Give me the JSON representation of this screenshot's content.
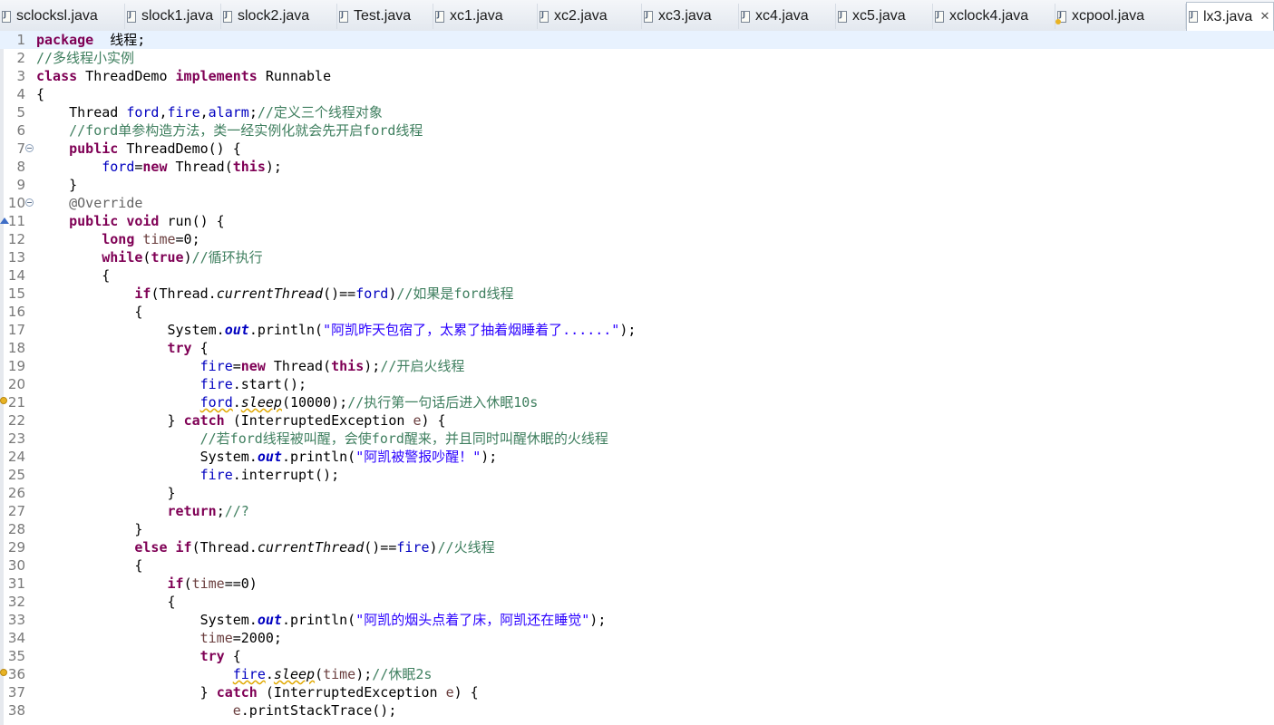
{
  "tabs": [
    {
      "label": "sclocksl.java",
      "active": false,
      "warn": false
    },
    {
      "label": "slock1.java",
      "active": false,
      "warn": false
    },
    {
      "label": "slock2.java",
      "active": false,
      "warn": false
    },
    {
      "label": "Test.java",
      "active": false,
      "warn": false
    },
    {
      "label": "xc1.java",
      "active": false,
      "warn": false
    },
    {
      "label": "xc2.java",
      "active": false,
      "warn": false
    },
    {
      "label": "xc3.java",
      "active": false,
      "warn": false
    },
    {
      "label": "xc4.java",
      "active": false,
      "warn": false
    },
    {
      "label": "xc5.java",
      "active": false,
      "warn": false
    },
    {
      "label": "xclock4.java",
      "active": false,
      "warn": false
    },
    {
      "label": "xcpool.java",
      "active": false,
      "warn": true
    },
    {
      "label": "lx3.java",
      "active": true,
      "warn": false,
      "close": "✕"
    }
  ],
  "editor": {
    "current_line": 1,
    "lines": [
      {
        "n": "1",
        "t": [
          [
            "kw",
            "package"
          ],
          [
            "",
            "  线程;"
          ]
        ]
      },
      {
        "n": "2",
        "t": [
          [
            "cm",
            "//多线程小实例"
          ]
        ]
      },
      {
        "n": "3",
        "t": [
          [
            "kw",
            "class"
          ],
          [
            "",
            " ThreadDemo "
          ],
          [
            "kw",
            "implements"
          ],
          [
            "",
            " Runnable"
          ]
        ]
      },
      {
        "n": "4",
        "t": [
          [
            "",
            "{"
          ]
        ]
      },
      {
        "n": "5",
        "t": [
          [
            "",
            "    Thread "
          ],
          [
            "fd",
            "ford"
          ],
          [
            "",
            ","
          ],
          [
            "fd",
            "fire"
          ],
          [
            "",
            ","
          ],
          [
            "fd",
            "alarm"
          ],
          [
            "",
            ";"
          ],
          [
            "cm",
            "//定义三个线程对象"
          ]
        ]
      },
      {
        "n": "6",
        "t": [
          [
            "cm",
            "    //ford单参构造方法，类一经实例化就会先开启ford线程"
          ]
        ]
      },
      {
        "n": "7",
        "fold": true,
        "t": [
          [
            "",
            "    "
          ],
          [
            "kw",
            "public"
          ],
          [
            "",
            " ThreadDemo() {"
          ]
        ]
      },
      {
        "n": "8",
        "t": [
          [
            "",
            "        "
          ],
          [
            "fd",
            "ford"
          ],
          [
            "",
            "="
          ],
          [
            "kw",
            "new"
          ],
          [
            "",
            " Thread("
          ],
          [
            "kw",
            "this"
          ],
          [
            "",
            ");"
          ]
        ]
      },
      {
        "n": "9",
        "t": [
          [
            "",
            "    }"
          ]
        ]
      },
      {
        "n": "10",
        "fold": true,
        "t": [
          [
            "",
            "    "
          ],
          [
            "an",
            "@Override"
          ]
        ]
      },
      {
        "n": "11",
        "marker": "override",
        "t": [
          [
            "",
            "    "
          ],
          [
            "kw",
            "public"
          ],
          [
            "",
            " "
          ],
          [
            "kw",
            "void"
          ],
          [
            "",
            " run() {"
          ]
        ]
      },
      {
        "n": "12",
        "t": [
          [
            "",
            "        "
          ],
          [
            "kw",
            "long"
          ],
          [
            "",
            " "
          ],
          [
            "lv",
            "time"
          ],
          [
            "",
            "=0;"
          ]
        ]
      },
      {
        "n": "13",
        "t": [
          [
            "",
            "        "
          ],
          [
            "kw",
            "while"
          ],
          [
            "",
            "("
          ],
          [
            "kw",
            "true"
          ],
          [
            "",
            ")"
          ],
          [
            "cm",
            "//循环执行"
          ]
        ]
      },
      {
        "n": "14",
        "t": [
          [
            "",
            "        {"
          ]
        ]
      },
      {
        "n": "15",
        "t": [
          [
            "",
            "            "
          ],
          [
            "kw",
            "if"
          ],
          [
            "",
            "(Thread."
          ],
          [
            "sm",
            "currentThread"
          ],
          [
            "",
            "()=="
          ],
          [
            "fd",
            "ford"
          ],
          [
            "",
            ")"
          ],
          [
            "cm",
            "//如果是ford线程"
          ]
        ]
      },
      {
        "n": "16",
        "t": [
          [
            "",
            "            {"
          ]
        ]
      },
      {
        "n": "17",
        "t": [
          [
            "",
            "                System."
          ],
          [
            "sf",
            "out"
          ],
          [
            "",
            ".println("
          ],
          [
            "st",
            "\"阿凯昨天包宿了，太累了抽着烟睡着了......\""
          ],
          [
            "",
            ");"
          ]
        ]
      },
      {
        "n": "18",
        "t": [
          [
            "",
            "                "
          ],
          [
            "kw",
            "try"
          ],
          [
            "",
            " {"
          ]
        ]
      },
      {
        "n": "19",
        "t": [
          [
            "",
            "                    "
          ],
          [
            "fd",
            "fire"
          ],
          [
            "",
            "="
          ],
          [
            "kw",
            "new"
          ],
          [
            "",
            " Thread("
          ],
          [
            "kw",
            "this"
          ],
          [
            "",
            ");"
          ],
          [
            "cm",
            "//开启火线程"
          ]
        ]
      },
      {
        "n": "20",
        "t": [
          [
            "",
            "                    "
          ],
          [
            "fd",
            "fire"
          ],
          [
            "",
            ".start();"
          ]
        ]
      },
      {
        "n": "21",
        "marker": "warn",
        "t": [
          [
            "",
            "                    "
          ],
          [
            "fd squig",
            "ford"
          ],
          [
            "",
            "."
          ],
          [
            "sm squig",
            "sleep"
          ],
          [
            "",
            "(10000);"
          ],
          [
            "cm",
            "//执行第一句话后进入休眠10s"
          ]
        ]
      },
      {
        "n": "22",
        "t": [
          [
            "",
            "                } "
          ],
          [
            "kw",
            "catch"
          ],
          [
            "",
            " (InterruptedException "
          ],
          [
            "lv",
            "e"
          ],
          [
            "",
            ") {"
          ]
        ]
      },
      {
        "n": "23",
        "t": [
          [
            "cm",
            "                    //若ford线程被叫醒，会使ford醒来，并且同时叫醒休眠的火线程"
          ]
        ]
      },
      {
        "n": "24",
        "t": [
          [
            "",
            "                    System."
          ],
          [
            "sf",
            "out"
          ],
          [
            "",
            ".println("
          ],
          [
            "st",
            "\"阿凯被警报吵醒！\""
          ],
          [
            "",
            ");"
          ]
        ]
      },
      {
        "n": "25",
        "t": [
          [
            "",
            "                    "
          ],
          [
            "fd",
            "fire"
          ],
          [
            "",
            ".interrupt();"
          ]
        ]
      },
      {
        "n": "26",
        "t": [
          [
            "",
            "                }"
          ]
        ]
      },
      {
        "n": "27",
        "t": [
          [
            "",
            "                "
          ],
          [
            "kw",
            "return"
          ],
          [
            "",
            ";"
          ],
          [
            "cm",
            "//?"
          ]
        ]
      },
      {
        "n": "28",
        "t": [
          [
            "",
            "            }"
          ]
        ]
      },
      {
        "n": "29",
        "t": [
          [
            "",
            "            "
          ],
          [
            "kw",
            "else"
          ],
          [
            "",
            " "
          ],
          [
            "kw",
            "if"
          ],
          [
            "",
            "(Thread."
          ],
          [
            "sm",
            "currentThread"
          ],
          [
            "",
            "()=="
          ],
          [
            "fd",
            "fire"
          ],
          [
            "",
            ")"
          ],
          [
            "cm",
            "//火线程"
          ]
        ]
      },
      {
        "n": "30",
        "t": [
          [
            "",
            "            {"
          ]
        ]
      },
      {
        "n": "31",
        "t": [
          [
            "",
            "                "
          ],
          [
            "kw",
            "if"
          ],
          [
            "",
            "("
          ],
          [
            "lv",
            "time"
          ],
          [
            "",
            "==0)"
          ]
        ]
      },
      {
        "n": "32",
        "t": [
          [
            "",
            "                {"
          ]
        ]
      },
      {
        "n": "33",
        "t": [
          [
            "",
            "                    System."
          ],
          [
            "sf",
            "out"
          ],
          [
            "",
            ".println("
          ],
          [
            "st",
            "\"阿凯的烟头点着了床，阿凯还在睡觉\""
          ],
          [
            "",
            ");"
          ]
        ]
      },
      {
        "n": "34",
        "t": [
          [
            "",
            "                    "
          ],
          [
            "lv",
            "time"
          ],
          [
            "",
            "=2000;"
          ]
        ]
      },
      {
        "n": "35",
        "t": [
          [
            "",
            "                    "
          ],
          [
            "kw",
            "try"
          ],
          [
            "",
            " {"
          ]
        ]
      },
      {
        "n": "36",
        "marker": "warn",
        "t": [
          [
            "",
            "                        "
          ],
          [
            "fd squig",
            "fire"
          ],
          [
            "",
            "."
          ],
          [
            "sm squig",
            "sleep"
          ],
          [
            "",
            "("
          ],
          [
            "lv",
            "time"
          ],
          [
            "",
            ");"
          ],
          [
            "cm",
            "//休眠2s"
          ]
        ]
      },
      {
        "n": "37",
        "t": [
          [
            "",
            "                    } "
          ],
          [
            "kw",
            "catch"
          ],
          [
            "",
            " (InterruptedException "
          ],
          [
            "lv",
            "e"
          ],
          [
            "",
            ") {"
          ]
        ]
      },
      {
        "n": "38",
        "t": [
          [
            "",
            "                        "
          ],
          [
            "lv",
            "e"
          ],
          [
            "",
            ".printStackTrace();"
          ]
        ]
      }
    ]
  }
}
